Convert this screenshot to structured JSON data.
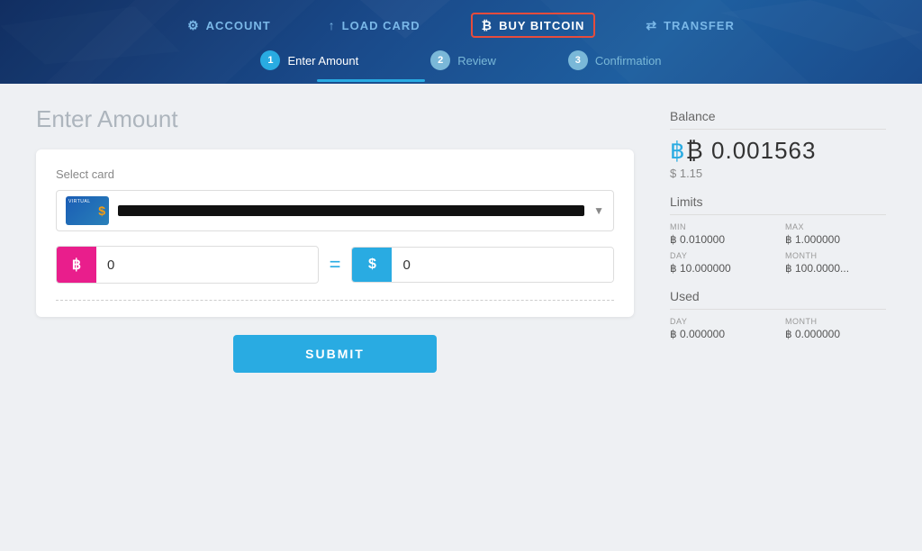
{
  "header": {
    "nav": {
      "account_label": "ACCOUNT",
      "load_card_label": "LOAD CARD",
      "buy_bitcoin_label": "BUY BITCOIN",
      "transfer_label": "TRANSFER"
    },
    "steps": [
      {
        "num": "1",
        "label": "Enter Amount",
        "active": true
      },
      {
        "num": "2",
        "label": "Review",
        "active": false
      },
      {
        "num": "3",
        "label": "Confirmation",
        "active": false
      }
    ]
  },
  "main": {
    "page_title": "Enter Amount",
    "select_card_label": "Select card",
    "card_number_placeholder": "••••••••••••••••",
    "bitcoin_amount": "0",
    "usd_amount": "0",
    "submit_label": "SUBMIT"
  },
  "sidebar": {
    "balance_label": "Balance",
    "balance_btc": "₿ 0.001563",
    "balance_usd": "$ 1.15",
    "limits_label": "Limits",
    "limits": {
      "min_key": "MIN",
      "min_val": "฿ 0.010000",
      "max_key": "MAX",
      "max_val": "฿ 1.000000",
      "day_key": "DAY",
      "day_val": "฿ 10.000000",
      "month_key": "MONTH",
      "month_val": "฿ 100.0000..."
    },
    "used_label": "Used",
    "used": {
      "day_key": "DAY",
      "day_val": "฿ 0.000000",
      "month_key": "MONTH",
      "month_val": "฿ 0.000000"
    }
  }
}
